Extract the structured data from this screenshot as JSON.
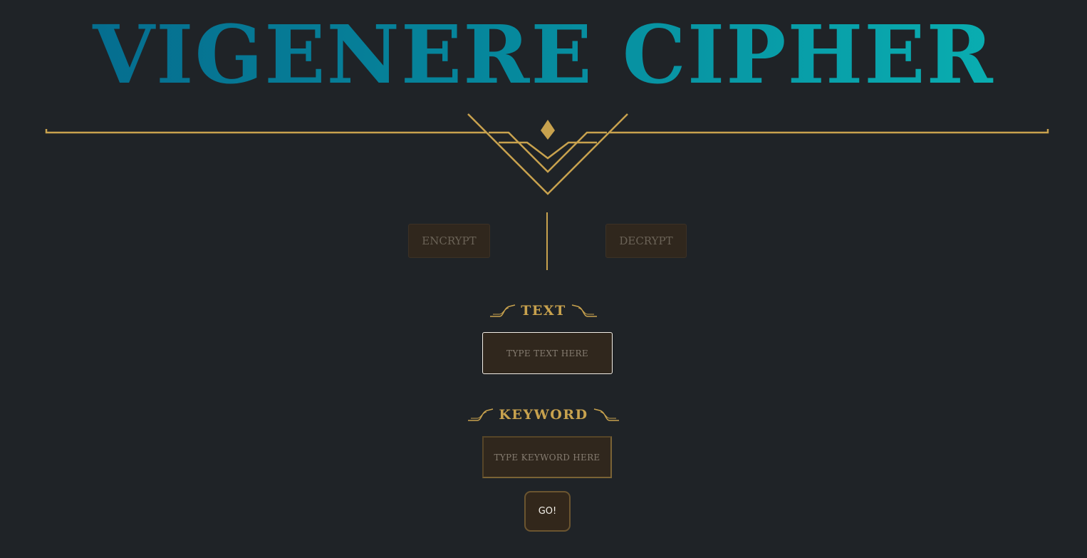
{
  "title": "VIGENERE CIPHER",
  "modes": {
    "encrypt_label": "ENCRYPT",
    "decrypt_label": "DECRYPT"
  },
  "text_section": {
    "label": "TEXT",
    "placeholder": "TYPE TEXT HERE",
    "value": ""
  },
  "keyword_section": {
    "label": "KEYWORD",
    "placeholder": "TYPE KEYWORD HERE",
    "value": ""
  },
  "go_label": "GO!",
  "colors": {
    "background": "#1f2327",
    "gold": "#c8a24e",
    "title_gradient_start": "#05688c",
    "title_gradient_end": "#0ab4b4",
    "field_bg": "#30271d"
  },
  "icons": [
    "ornament-divider-icon",
    "label-flourish-left-icon",
    "label-flourish-right-icon"
  ]
}
